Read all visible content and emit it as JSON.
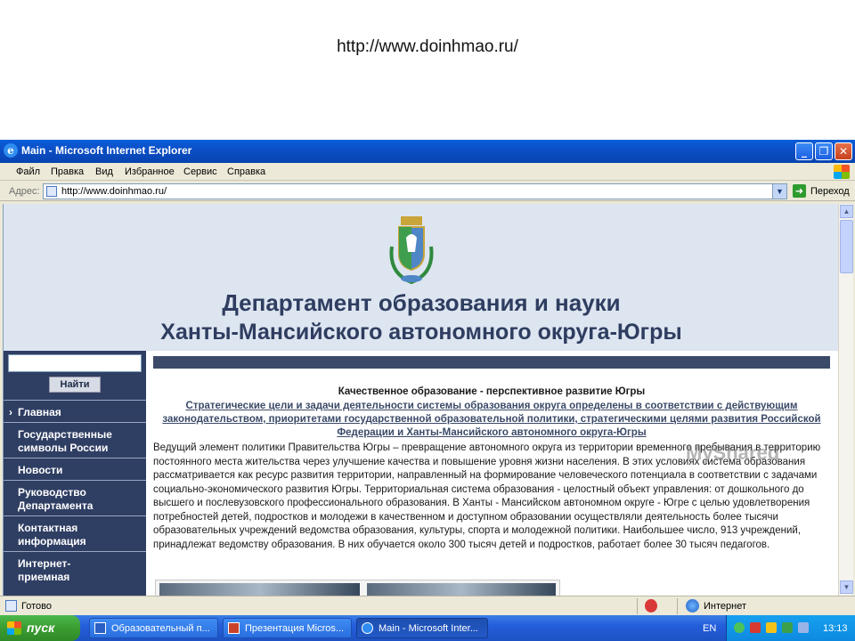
{
  "slide": {
    "url_text": "http://www.doinhmao.ru/"
  },
  "window": {
    "title": "Main - Microsoft Internet Explorer",
    "menu": [
      "Файл",
      "Правка",
      "Вид",
      "Избранное",
      "Сервис",
      "Справка"
    ],
    "address_label": "Адрес:",
    "address_value": "http://www.doinhmao.ru/",
    "go_label": "Переход"
  },
  "page": {
    "header_line1": "Департамент образования и науки",
    "header_line2": "Ханты-Мансийского автономного округа-Югры",
    "search_button": "Найти",
    "nav": [
      "Главная",
      "Государственные символы России",
      "Новости",
      "Руководство Департамента",
      "Контактная информация",
      "Интернет-приемная"
    ],
    "main_title": "Качественное образование - перспективное развитие Югры",
    "main_link": "Стратегические цели и задачи деятельности системы образования округа определены в соответствии с действующим законодательством, приоритетами государственной образовательной политики, стратегическими целями развития Российской Федерации и Ханты-Мансийского автономного округа-Югры",
    "main_body": "Ведущий элемент политики Правительства Югры – превращение автономного округа из территории временного пребывания в территорию постоянного места жительства через улучшение качества и повышение уровня жизни населения. В этих условиях система образования рассматривается как ресурс развития территории, направленный на формирование человеческого потенциала в соответствии с задачами социально-экономического развития Югры. Территориальная система образования - целостный объект управления: от дошкольного до высшего и послевузовского профессионального образования. В Ханты - Мансийском автономном округе - Югре с целью удовлетворения потребностей детей, подростков и молодежи в качественном и доступном образовании осуществляли деятельность более тысячи образовательных учреждений ведомства образования, культуры, спорта и молодежной политики. Наибольшее число, 913 учреждений, принадлежат ведомству образования. В них обучается около 300 тысяч детей и подростков, работает более 30 тысяч педагогов."
  },
  "status": {
    "ready": "Готово",
    "zone": "Интернет"
  },
  "taskbar": {
    "start": "пуск",
    "tasks": [
      "Образовательный п...",
      "Презентация Micros...",
      "Main - Microsoft Inter..."
    ],
    "lang": "EN",
    "clock": "13:13"
  },
  "watermark": "MyShared"
}
